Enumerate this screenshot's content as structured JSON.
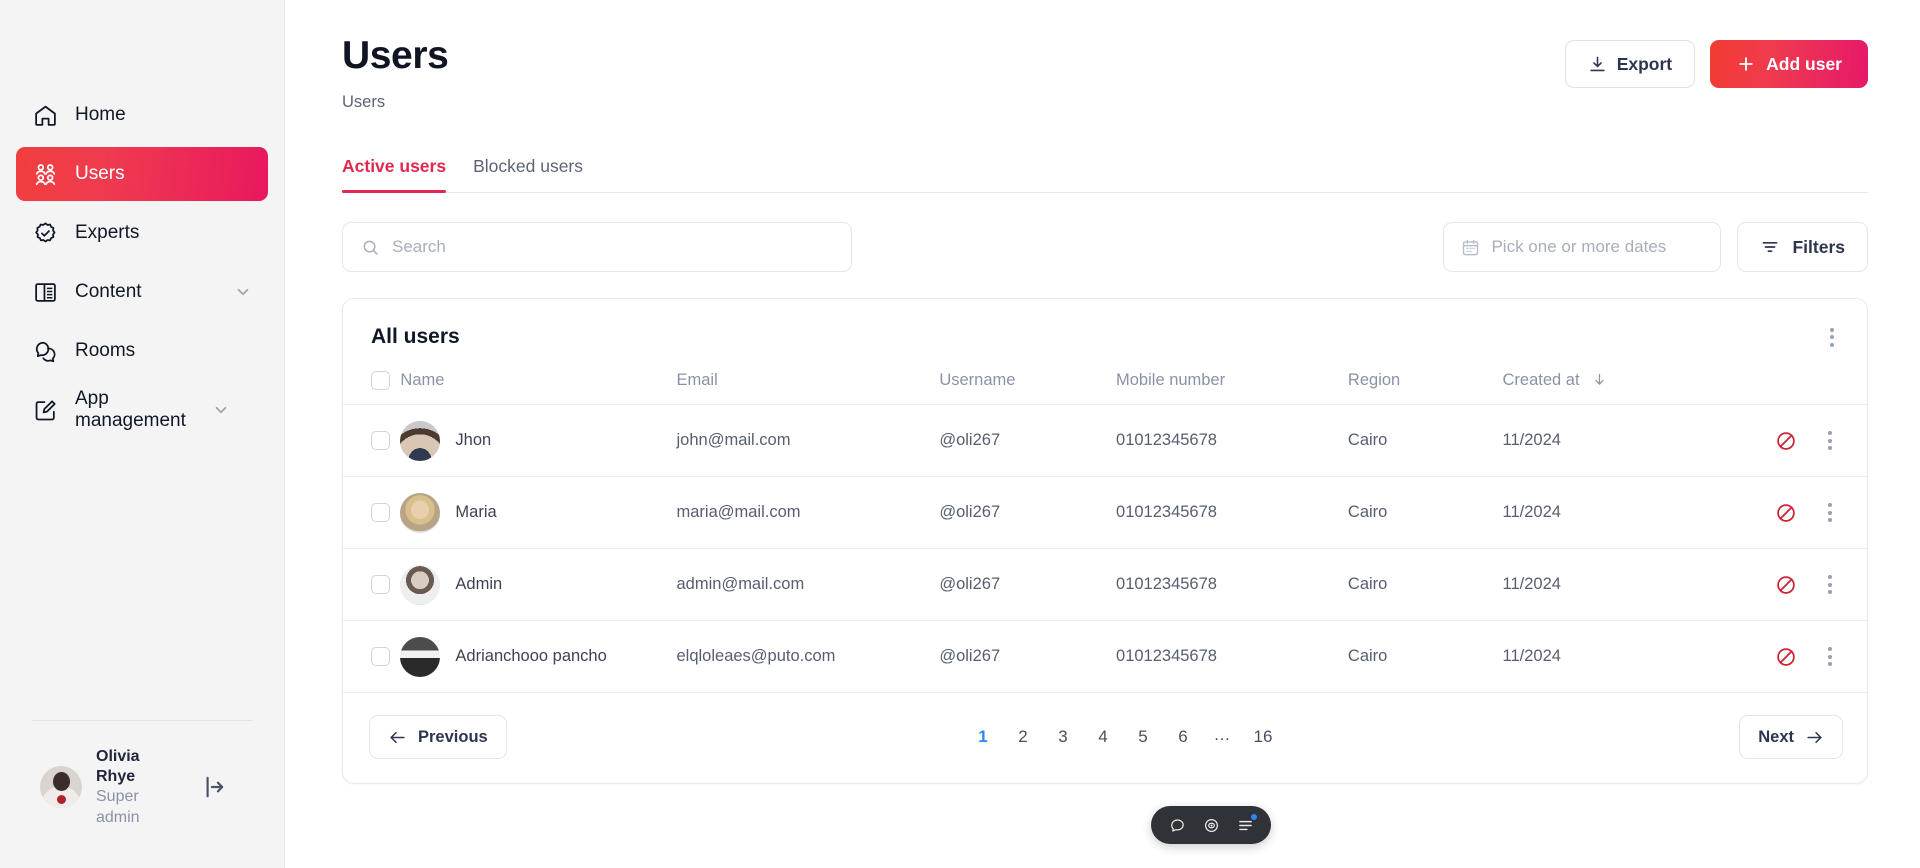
{
  "sidebar": {
    "items": [
      {
        "label": "Home",
        "icon": "home-icon",
        "active": false,
        "chevron": false
      },
      {
        "label": "Users",
        "icon": "users-icon",
        "active": true,
        "chevron": false
      },
      {
        "label": "Experts",
        "icon": "badge-check-icon",
        "active": false,
        "chevron": false
      },
      {
        "label": "Content",
        "icon": "layout-panel-icon",
        "active": false,
        "chevron": true
      },
      {
        "label": "Rooms",
        "icon": "chat-bubbles-icon",
        "active": false,
        "chevron": false
      },
      {
        "label": "App management",
        "icon": "edit-square-icon",
        "active": false,
        "chevron": true
      }
    ],
    "profile": {
      "name": "Olivia Rhye",
      "role": "Super admin",
      "logout_icon": "logout-icon",
      "avatar": "avatar"
    }
  },
  "header": {
    "title": "Users",
    "breadcrumb": "Users",
    "export_label": "Export",
    "export_icon": "download-icon",
    "add_user_label": "Add user",
    "add_user_icon": "plus-icon"
  },
  "tabs": [
    {
      "label": "Active users",
      "active": true
    },
    {
      "label": "Blocked users",
      "active": false
    }
  ],
  "filters": {
    "search_placeholder": "Search",
    "search_value": "",
    "search_icon": "search-icon",
    "date_placeholder": "Pick one or more dates",
    "date_value": "",
    "date_icon": "calendar-icon",
    "filters_label": "Filters",
    "filters_icon": "filter-icon"
  },
  "table": {
    "title": "All users",
    "menu_icon": "kebab-menu-icon",
    "columns": [
      {
        "key": "name",
        "label": "Name"
      },
      {
        "key": "email",
        "label": "Email"
      },
      {
        "key": "username",
        "label": "Username"
      },
      {
        "key": "mobile",
        "label": "Mobile number"
      },
      {
        "key": "region",
        "label": "Region"
      },
      {
        "key": "created",
        "label": "Created at",
        "sorted": "desc"
      }
    ],
    "rows": [
      {
        "name": "Jhon",
        "email": "john@mail.com",
        "username": "@oli267",
        "mobile": "01012345678",
        "region": "Cairo",
        "created": "11/2024",
        "avatar_kind": "man",
        "block_icon": "block-icon",
        "menu_icon": "kebab-menu-icon"
      },
      {
        "name": "Maria",
        "email": "maria@mail.com",
        "username": "@oli267",
        "mobile": "01012345678",
        "region": "Cairo",
        "created": "11/2024",
        "avatar_kind": "blonde-woman",
        "block_icon": "block-icon",
        "menu_icon": "kebab-menu-icon"
      },
      {
        "name": "Admin",
        "email": "admin@mail.com",
        "username": "@oli267",
        "mobile": "01012345678",
        "region": "Cairo",
        "created": "11/2024",
        "avatar_kind": "woman",
        "block_icon": "block-icon",
        "menu_icon": "kebab-menu-icon"
      },
      {
        "name": "Adrianchooo pancho",
        "email": "elqloleaes@puto.com",
        "username": "@oli267",
        "mobile": "01012345678",
        "region": "Cairo",
        "created": "11/2024",
        "avatar_kind": "landscape",
        "block_icon": "block-icon",
        "menu_icon": "kebab-menu-icon"
      }
    ]
  },
  "pagination": {
    "previous_label": "Previous",
    "previous_icon": "arrow-left-icon",
    "next_label": "Next",
    "next_icon": "arrow-right-icon",
    "pages": [
      "1",
      "2",
      "3",
      "4",
      "5",
      "6",
      "…",
      "16"
    ],
    "current_page": "1"
  },
  "float_toolbar": {
    "items": [
      {
        "icon": "chat-icon",
        "badge": false
      },
      {
        "icon": "eye-icon",
        "badge": false
      },
      {
        "icon": "menu-lines-icon",
        "badge": true
      }
    ]
  },
  "colors": {
    "brand_start": "#f23b32",
    "brand_end": "#e6186a",
    "tab_active": "#e1294f",
    "page_active": "#2f86f6",
    "block_red": "#cf2232",
    "sidebar_bg": "#f4f4f5"
  }
}
